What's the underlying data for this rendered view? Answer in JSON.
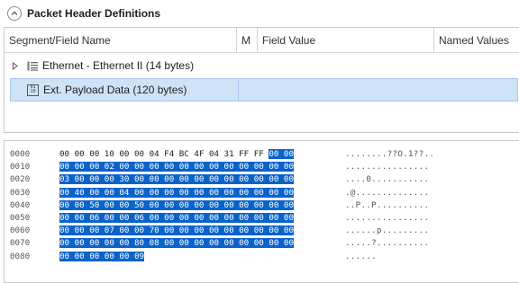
{
  "section": {
    "title": "Packet Header Definitions",
    "collapse_icon": "chevron-up-icon"
  },
  "grid": {
    "columns": [
      "Segment/Field Name",
      "M",
      "Field Value",
      "Named Values"
    ],
    "rows": [
      {
        "label": "Ethernet - Ethernet II (14 bytes)",
        "icon": "list-icon",
        "expander": "triangle-right-icon",
        "selected": false
      },
      {
        "label": "Ext. Payload Data (120 bytes)",
        "icon": "binary-icon",
        "icon_text": [
          "01",
          "10"
        ],
        "selected": true
      }
    ]
  },
  "hex": {
    "selection_color": "#0a63c9",
    "lines": [
      {
        "offset": "0000",
        "plain": "00 00 00 10 00 00 04 F4 BC 4F 04 31 FF FF ",
        "sel": "00 00",
        "ascii": "........??O.1??.."
      },
      {
        "offset": "0010",
        "plain": "",
        "sel": "00 00 00 02 00 00 00 00 00 00 00 00 00 00 00 00",
        "ascii": "................"
      },
      {
        "offset": "0020",
        "plain": "",
        "sel": "03 00 00 00 30 00 00 00 00 00 00 00 00 00 00 00",
        "ascii": "....0..........."
      },
      {
        "offset": "0030",
        "plain": "",
        "sel": "00 40 00 00 04 00 00 00 00 00 00 00 00 00 00 00",
        "ascii": ".@.............."
      },
      {
        "offset": "0040",
        "plain": "",
        "sel": "00 00 50 00 00 50 00 00 00 00 00 00 00 00 00 00",
        "ascii": "..P..P.........."
      },
      {
        "offset": "0050",
        "plain": "",
        "sel": "00 00 06 00 00 06 00 00 00 00 00 00 00 00 00 00",
        "ascii": "................"
      },
      {
        "offset": "0060",
        "plain": "",
        "sel": "00 00 00 07 00 00 70 00 00 00 00 00 00 00 00 00",
        "ascii": "......p........."
      },
      {
        "offset": "0070",
        "plain": "",
        "sel": "00 00 00 00 00 80 08 00 00 00 00 00 00 00 00 00",
        "ascii": ".....?.........."
      },
      {
        "offset": "0080",
        "plain": "",
        "sel": "00 00 00 00 00 09",
        "ascii": "......"
      }
    ]
  }
}
